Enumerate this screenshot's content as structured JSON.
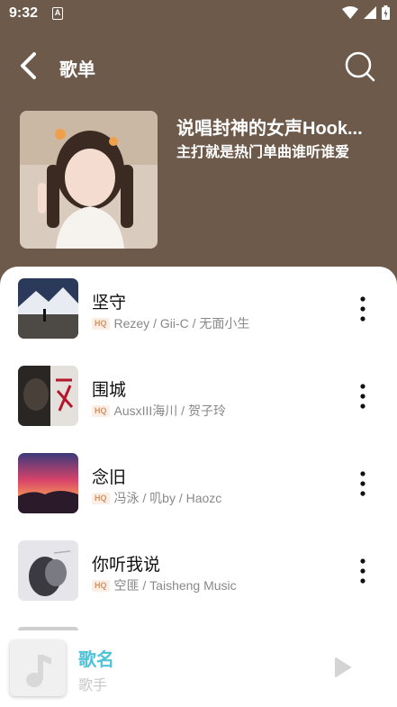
{
  "status_bar": {
    "time": "9:32",
    "app_badge": "A"
  },
  "header": {
    "title": "歌单"
  },
  "playlist": {
    "title": "说唱封神的女声Hook...",
    "subtitle": "主打就是热门单曲谁听谁爱"
  },
  "songs": [
    {
      "title": "坚守",
      "quality": "HQ",
      "artists": "Rezey / Gii-C / 无面小生"
    },
    {
      "title": "围城",
      "quality": "HQ",
      "artists": "AusxIII海川 / 贺子玲"
    },
    {
      "title": "念旧",
      "quality": "HQ",
      "artists": "冯泳 / 叽by / Haozc"
    },
    {
      "title": "你听我说",
      "quality": "HQ",
      "artists": "空匪 / Taisheng Music"
    }
  ],
  "player": {
    "song_name": "歌名",
    "artist": "歌手"
  },
  "colors": {
    "header_bg": "#6d5a4b",
    "accent": "#4fc3d8",
    "hq_text": "#d0946a",
    "hq_bg": "#fbeee4"
  },
  "icons": {
    "back": "chevron-left-icon",
    "search": "search-icon",
    "more": "more-vertical-icon",
    "music_note": "music-note-icon",
    "play": "play-icon"
  }
}
